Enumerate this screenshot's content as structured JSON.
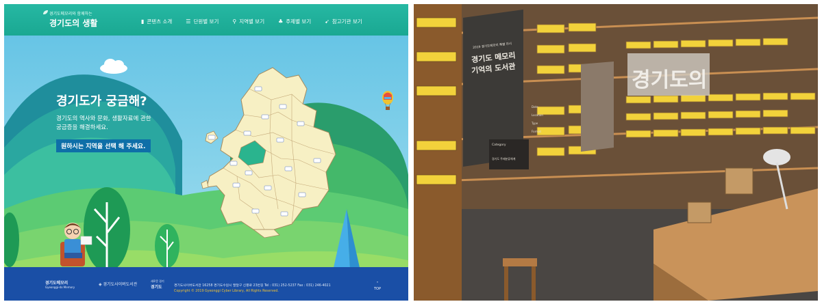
{
  "header": {
    "logo_small": "경기도메모리와 함께하는",
    "logo_title": "경기도의 생활",
    "nav": [
      {
        "label": "콘텐츠 소개",
        "icon": "book-icon",
        "glyph": "▮"
      },
      {
        "label": "단원별 보기",
        "icon": "list-icon",
        "glyph": "☰"
      },
      {
        "label": "지역별 보기",
        "icon": "location-pin-icon",
        "glyph": "⚲"
      },
      {
        "label": "주제별 보기",
        "icon": "topic-icon",
        "glyph": "♣"
      },
      {
        "label": "참고기관 보기",
        "icon": "send-icon",
        "glyph": "➹"
      }
    ]
  },
  "hero": {
    "title": "경기도가 궁금해?",
    "desc_line1": "경기도의 역사와 문화, 생활자료에 관한",
    "desc_line2": "궁금증을 해결하세요.",
    "cta": "원하시는 지역을 선택 해 주세요."
  },
  "footer": {
    "logo1": "경기도메모리",
    "logo1_sub": "Gyeonggi-do Memory",
    "logo2": "경기도사이버도서관",
    "logo3": "경기도",
    "logo3_sub": "새로운 경기",
    "address": "경기도사이버도서관 16258 경기도수원시 팔달구 신풍로 23번길   Tel : 031) 252-5237   Fax : 031) 246-4021",
    "copyright": "Copyright © 2019 Gyeonggi Cyber Library, All Rights Reserved.",
    "top_label": "TOP"
  },
  "photo": {
    "sign_small": "2019 경기도메모리 특별 전시",
    "sign_line1": "경기도 메모리",
    "sign_line2": "기억의 도서관",
    "wall_text": "경기도의",
    "panel_lines": [
      "Category",
      "경기도 주제분류체계"
    ],
    "small_labels": [
      "Date",
      "Location",
      "Type",
      "Format"
    ]
  },
  "colors": {
    "header_bg": "#1fb09b",
    "footer_bg": "#1a4fa6",
    "cta_bg": "#0e6fa8",
    "map_fill": "#f7f0c4",
    "drawer_yellow": "#f2d23b"
  }
}
